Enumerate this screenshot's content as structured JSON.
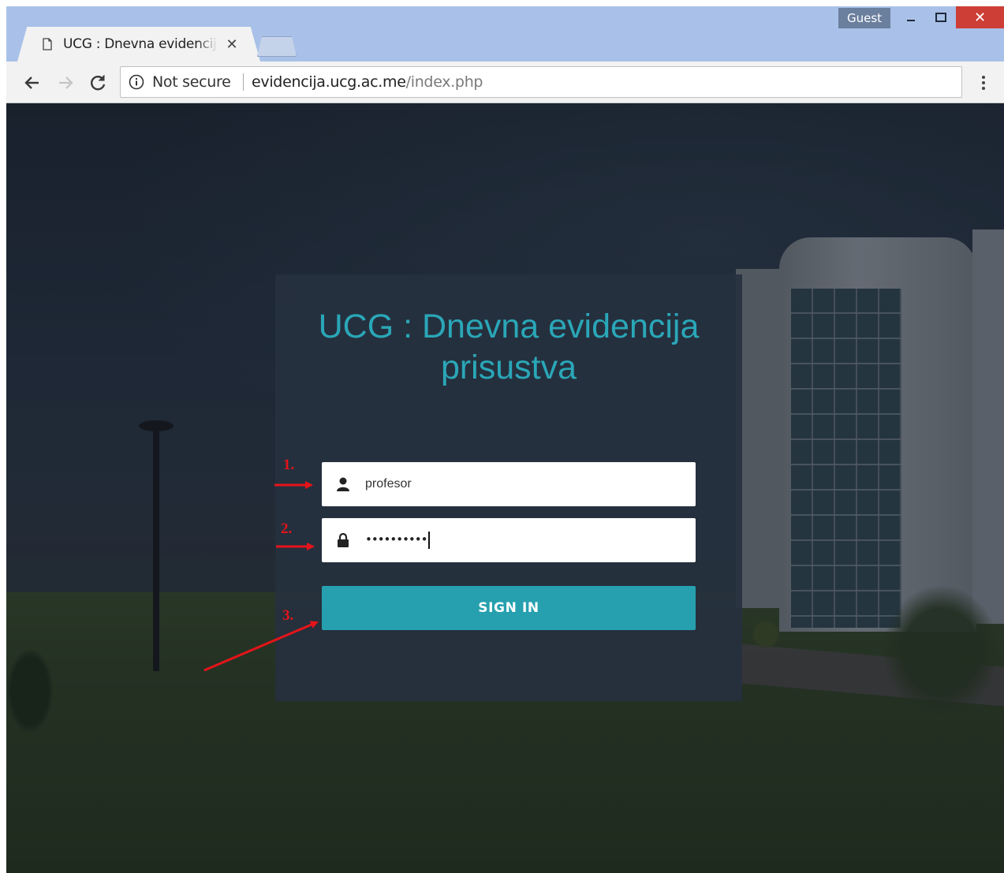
{
  "window": {
    "profile_label": "Guest",
    "close_glyph": "✕"
  },
  "tab": {
    "title": "UCG : Dnevna evidencija prisustva",
    "close_glyph": "✕",
    "icon": "page-icon"
  },
  "toolbar": {
    "security_label": "Not secure",
    "url_host": "evidencija.ucg.ac.me",
    "url_path": "/index.php"
  },
  "login": {
    "title": "UCG : Dnevna evidencija prisustva",
    "username_value": "profesor",
    "password_masked": "••••••••••",
    "signin_label": "SIGN IN"
  },
  "annotations": {
    "step1": "1.",
    "step2": "2.",
    "step3": "3.",
    "color": "#e5141a"
  },
  "colors": {
    "accent": "#26a0ae",
    "title": "#2aa7b8",
    "chrome": "#a9c1e8",
    "close": "#cd3e36"
  }
}
